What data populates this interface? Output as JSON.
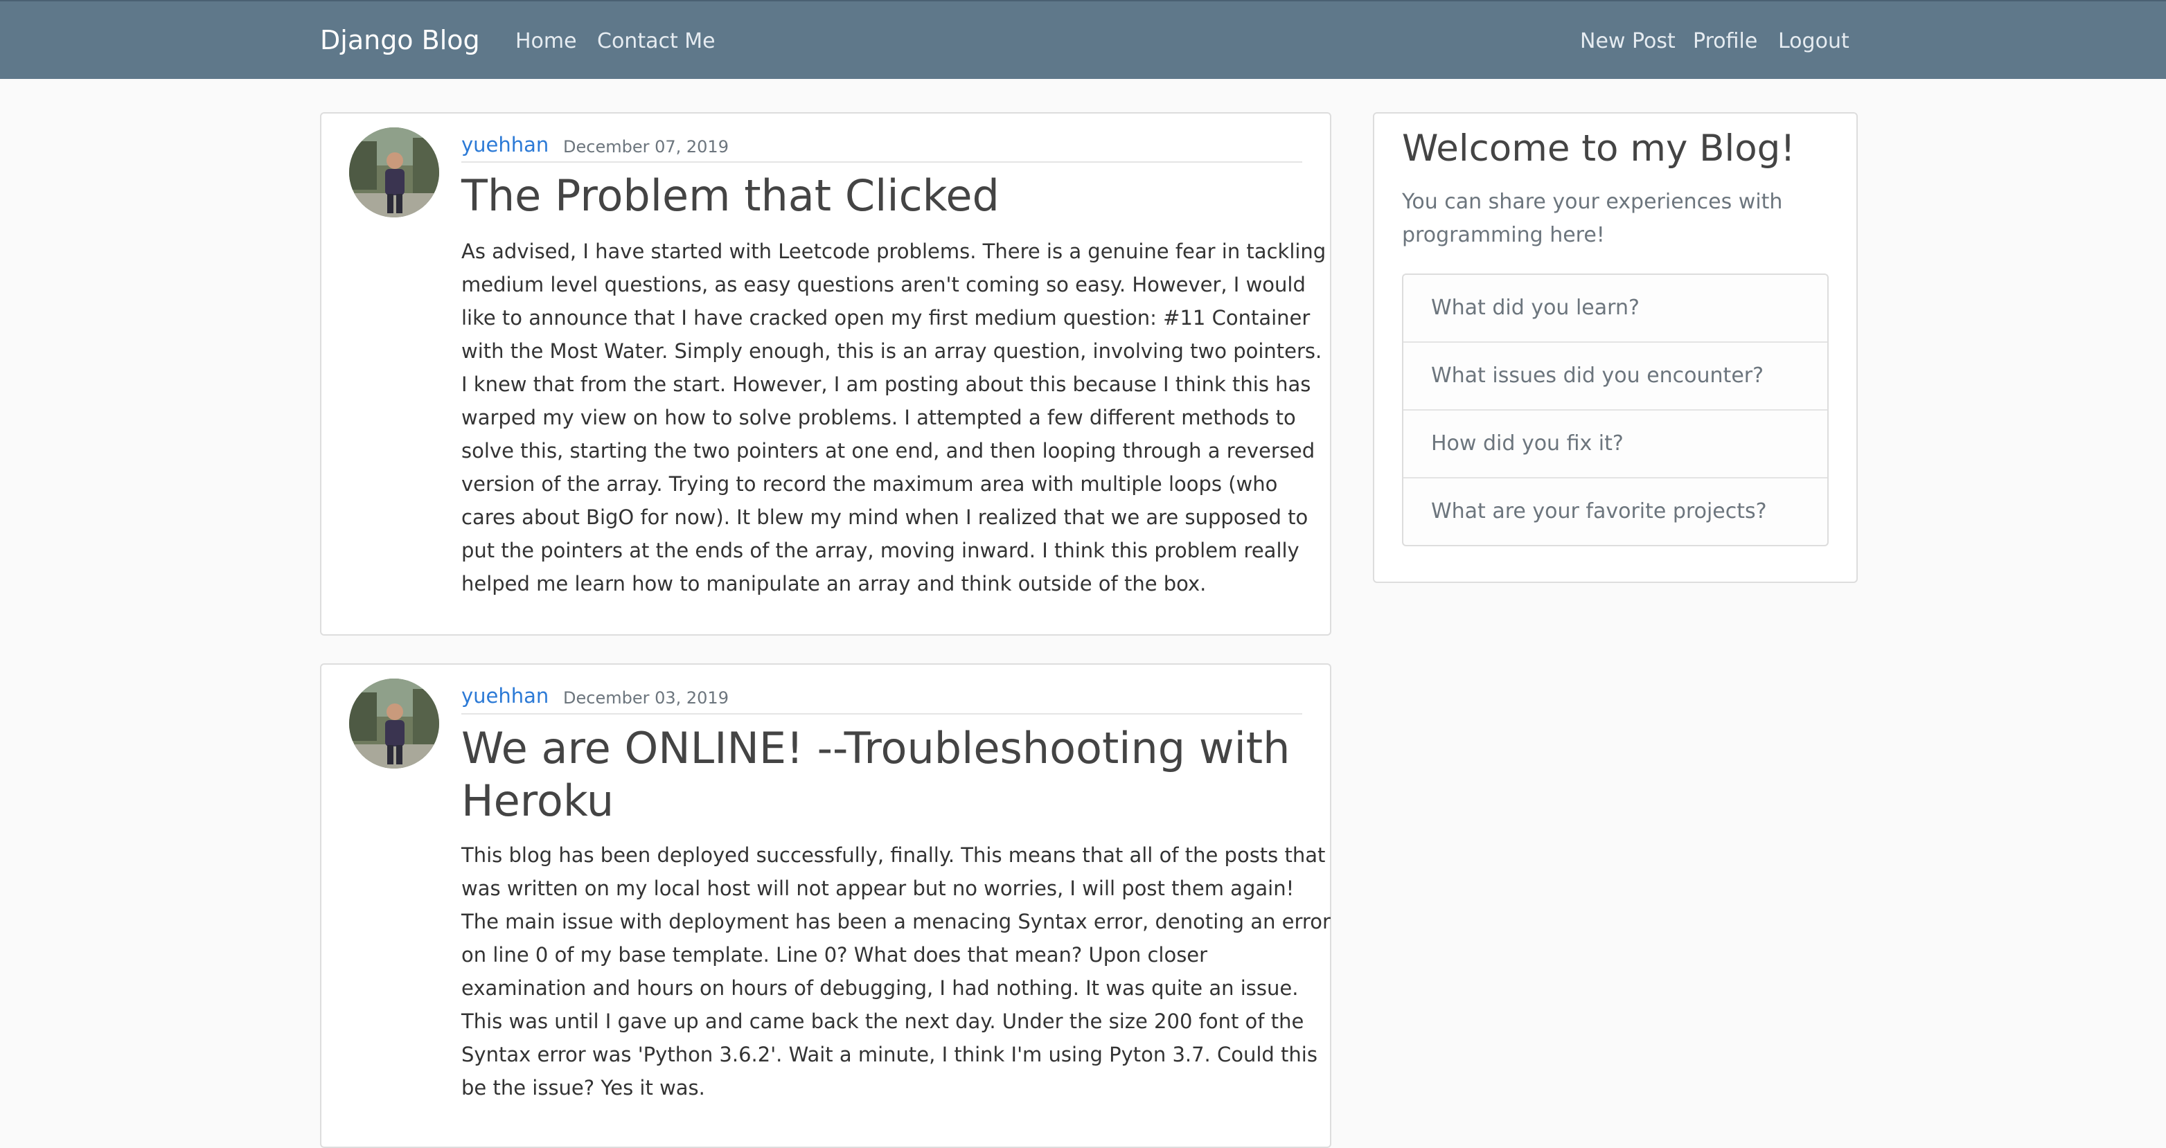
{
  "navbar": {
    "brand": "Django Blog",
    "links_left": [
      "Home",
      "Contact Me"
    ],
    "links_right": [
      "New Post",
      "Profile",
      "Logout"
    ]
  },
  "posts": [
    {
      "author": "yuehhan",
      "date": "December 07, 2019",
      "title": "The Problem that Clicked",
      "content_lines": [
        "As advised, I have started with Leetcode problems. There is a genuine fear in tackling",
        "medium level questions, as easy questions aren't coming so easy. However, I would",
        "like to announce that I have cracked open my first medium question: #11 Container",
        "with the Most Water. Simply enough, this is an array question, involving two pointers.",
        "I knew that from the start. However, I am posting about this because I think this has",
        "warped my view on how to solve problems. I attempted a few different methods to",
        "solve this, starting the two pointers at one end, and then looping through a reversed",
        "version of the array. Trying to record the maximum area with multiple loops (who",
        "cares about BigO for now). It blew my mind when I realized that we are supposed to",
        "put the pointers at the ends of the array, moving inward. I think this problem really",
        "helped me learn how to manipulate an array and think outside of the box."
      ]
    },
    {
      "author": "yuehhan",
      "date": "December 03, 2019",
      "title_lines": [
        "We are ONLINE! --Troubleshooting with",
        "Heroku"
      ],
      "content_lines": [
        "This blog has been deployed successfully, finally. This means that all of the posts that",
        "was written on my local host will not appear but no worries, I will post them again!",
        "The main issue with deployment has been a menacing Syntax error, denoting an error",
        "on line 0 of my base template. Line 0? What does that mean? Upon closer",
        "examination and hours on hours of debugging, I had nothing. It was quite an issue.",
        "This was until I gave up and came back the next day. Under the size 200 font of the",
        "Syntax error was 'Python 3.6.2'. Wait a minute, I think I'm using Pyton 3.7. Could this",
        "be the issue? Yes it was."
      ]
    }
  ],
  "sidebar": {
    "heading": "Welcome to my Blog!",
    "subtext_lines": [
      "You can share your experiences with",
      "programming here!"
    ],
    "items": [
      "What did you learn?",
      "What issues did you encounter?",
      "How did you fix it?",
      "What are your favorite projects?"
    ]
  },
  "colors": {
    "navbar": "#5f788a",
    "link": "#2c7ad6",
    "background": "#fafafa"
  }
}
